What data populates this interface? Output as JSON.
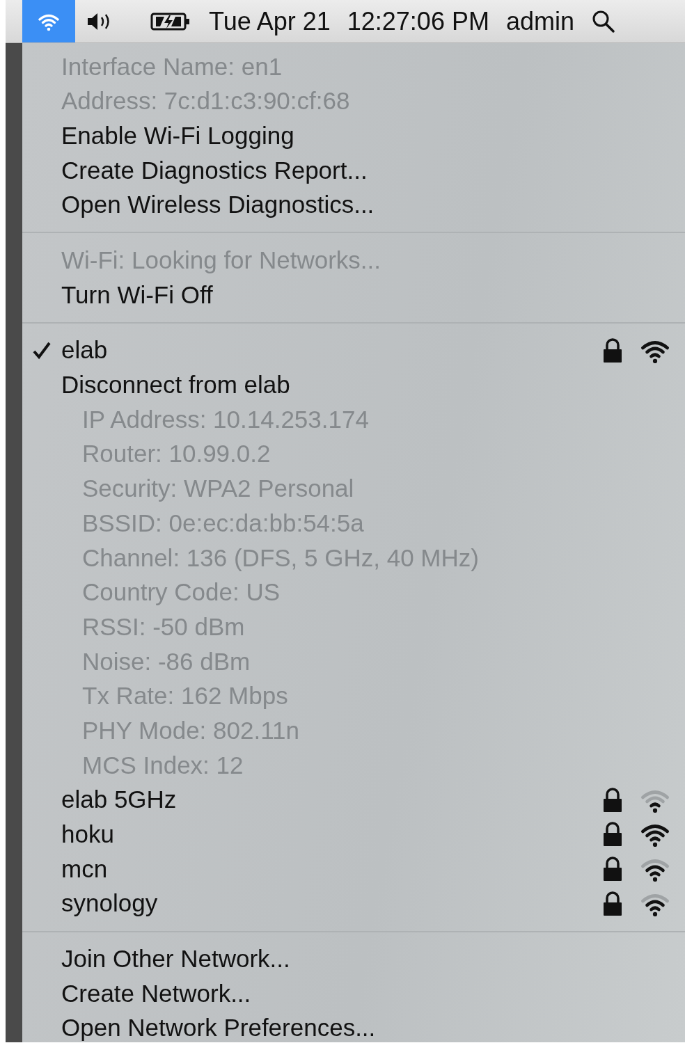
{
  "menu_bar": {
    "wifi_selected": true,
    "date": "Tue Apr 21",
    "time": "12:27:06 PM",
    "user": "admin"
  },
  "sections": [
    [
      {
        "kind": "info",
        "text": "Interface Name: en1"
      },
      {
        "kind": "info",
        "text": "Address: 7c:d1:c3:90:cf:68"
      },
      {
        "kind": "action",
        "text": "Enable Wi-Fi Logging"
      },
      {
        "kind": "action",
        "text": "Create Diagnostics Report..."
      },
      {
        "kind": "action",
        "text": "Open Wireless Diagnostics..."
      }
    ],
    [
      {
        "kind": "info",
        "text": "Wi-Fi: Looking for Networks..."
      },
      {
        "kind": "action",
        "text": "Turn Wi-Fi Off"
      }
    ],
    [
      {
        "kind": "network",
        "text": "elab",
        "checked": true,
        "locked": true,
        "arcs": [
          {
            "on": true
          },
          {
            "on": true
          },
          {
            "on": true
          }
        ]
      },
      {
        "kind": "action",
        "text": "Disconnect from elab"
      },
      {
        "kind": "detail",
        "text": "IP Address: 10.14.253.174"
      },
      {
        "kind": "detail",
        "text": "Router: 10.99.0.2"
      },
      {
        "kind": "detail",
        "text": "Security: WPA2 Personal"
      },
      {
        "kind": "detail",
        "text": "BSSID: 0e:ec:da:bb:54:5a"
      },
      {
        "kind": "detail",
        "text": "Channel: 136 (DFS, 5 GHz, 40 MHz)"
      },
      {
        "kind": "detail",
        "text": "Country Code: US"
      },
      {
        "kind": "detail",
        "text": "RSSI: -50 dBm"
      },
      {
        "kind": "detail",
        "text": "Noise: -86 dBm"
      },
      {
        "kind": "detail",
        "text": "Tx Rate: 162 Mbps"
      },
      {
        "kind": "detail",
        "text": "PHY Mode: 802.11n"
      },
      {
        "kind": "detail",
        "text": "MCS Index: 12"
      },
      {
        "kind": "network",
        "text": "elab 5GHz",
        "checked": false,
        "locked": true,
        "arcs": [
          {
            "on": true
          },
          {
            "on": false
          },
          {
            "on": false
          }
        ]
      },
      {
        "kind": "network",
        "text": "hoku",
        "checked": false,
        "locked": true,
        "arcs": [
          {
            "on": true
          },
          {
            "on": true
          },
          {
            "on": true
          }
        ]
      },
      {
        "kind": "network",
        "text": "mcn",
        "checked": false,
        "locked": true,
        "arcs": [
          {
            "on": true
          },
          {
            "on": true
          },
          {
            "on": false
          }
        ]
      },
      {
        "kind": "network",
        "text": "synology",
        "checked": false,
        "locked": true,
        "arcs": [
          {
            "on": true
          },
          {
            "on": true
          },
          {
            "on": false
          }
        ]
      }
    ],
    [
      {
        "kind": "action",
        "text": "Join Other Network..."
      },
      {
        "kind": "action",
        "text": "Create Network..."
      },
      {
        "kind": "action",
        "text": "Open Network Preferences..."
      }
    ]
  ]
}
